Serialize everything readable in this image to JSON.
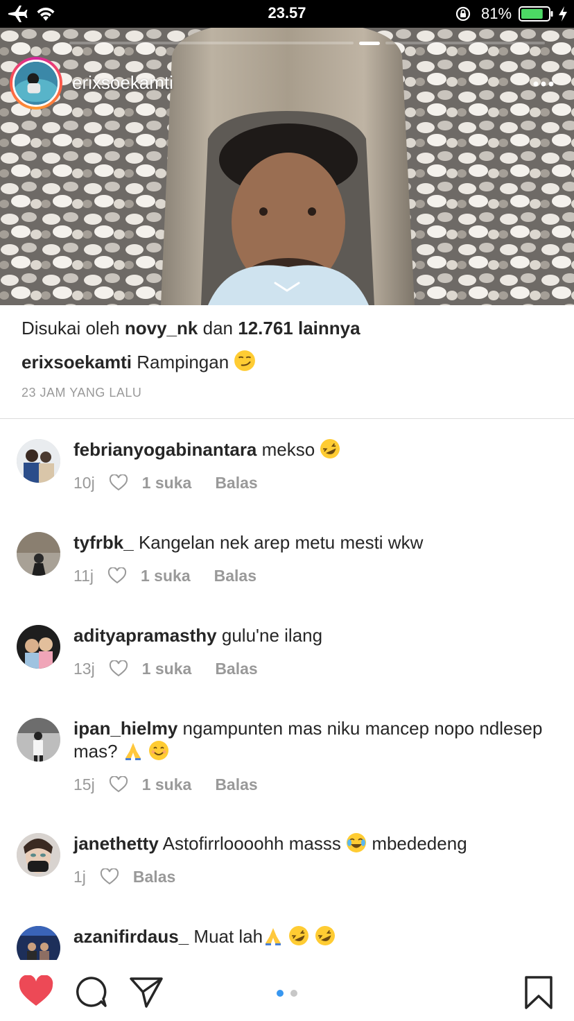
{
  "status_bar": {
    "time": "23.57",
    "battery_percent": "81%",
    "battery_level": 0.81,
    "icons": [
      "airplane-icon",
      "wifi-icon",
      "orientation-lock-icon",
      "battery-icon",
      "charging-bolt-icon"
    ]
  },
  "story": {
    "username": "erixsoekamti",
    "progress_segments": 3,
    "active_segment": 2
  },
  "post": {
    "likes_prefix": "Disukai oleh",
    "likes_user": "novy_nk",
    "likes_middle": "dan",
    "likes_count": "12.761 lainnya",
    "caption_user": "erixsoekamti",
    "caption_text": "Rampingan",
    "caption_emoji": "smirk-emoji",
    "timestamp": "23 JAM YANG LALU"
  },
  "comments": [
    {
      "username": "febrianyogabinantara",
      "text": "mekso",
      "emojis": [
        "rofl-emoji"
      ],
      "time": "10j",
      "likes": "1 suka",
      "reply": "Balas"
    },
    {
      "username": "tyfrbk_",
      "text": "Kangelan nek arep metu mesti wkw",
      "emojis": [],
      "time": "11j",
      "likes": "1 suka",
      "reply": "Balas"
    },
    {
      "username": "adityapramasthy",
      "text": "gulu'ne ilang",
      "emojis": [],
      "time": "13j",
      "likes": "1 suka",
      "reply": "Balas"
    },
    {
      "username": "ipan_hielmy",
      "text": "ngampunten mas niku mancep nopo ndlesep mas?",
      "emojis": [
        "pray-emoji",
        "smile-emoji"
      ],
      "time": "15j",
      "likes": "1 suka",
      "reply": "Balas"
    },
    {
      "username": "janethetty",
      "text": "Astofirrloooohh masss",
      "emojis": [
        "joy-emoji"
      ],
      "text_after": "mbededeng",
      "time": "1j",
      "likes": "",
      "reply": "Balas"
    },
    {
      "username": "azanifirdaus_",
      "text": "Muat lah",
      "emojis": [
        "pray-emoji",
        "rofl-emoji",
        "rofl-emoji"
      ]
    }
  ],
  "bottom_bar": {
    "icons": [
      "heart-filled-icon",
      "comment-icon",
      "send-icon",
      "page-dots-indicator",
      "save-bookmark-icon"
    ],
    "heart_color": "#ed4956",
    "dot_active_color": "#3897f0"
  }
}
